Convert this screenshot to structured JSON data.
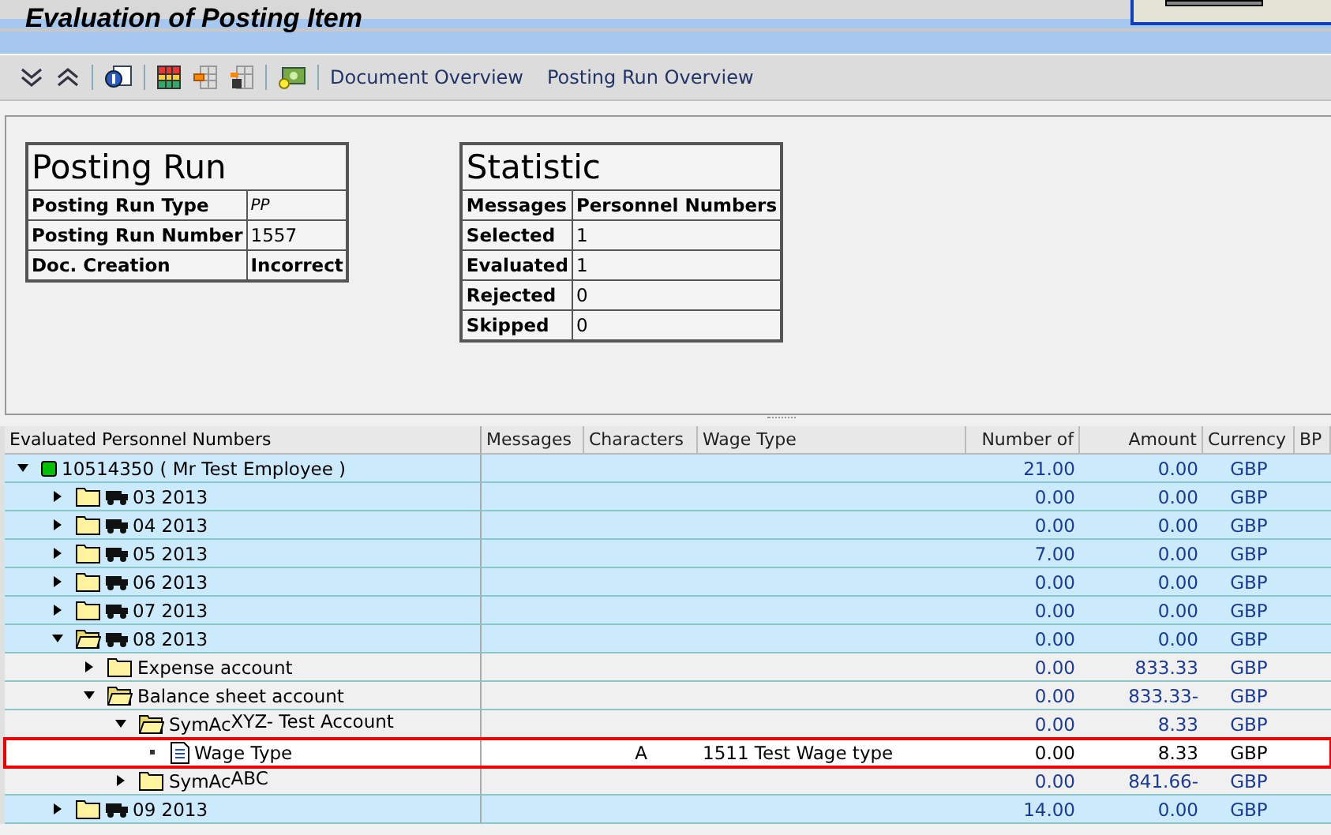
{
  "window": {
    "title": "Evaluation of Posting Item"
  },
  "toolbar": {
    "links": [
      "Document Overview",
      "Posting Run Overview"
    ]
  },
  "posting_run": {
    "title": "Posting Run",
    "rows": [
      {
        "label": "Posting Run Type",
        "value": "PP",
        "italic": true
      },
      {
        "label": "Posting Run Number",
        "value": "1557",
        "italic": false
      },
      {
        "label": "Doc. Creation",
        "value": "Incorrect",
        "italic": false,
        "bold": true
      }
    ]
  },
  "statistic": {
    "title": "Statistic",
    "header": [
      "Messages",
      "Personnel Numbers"
    ],
    "rows": [
      {
        "label": "Selected",
        "value": "1"
      },
      {
        "label": "Evaluated",
        "value": "1"
      },
      {
        "label": "Rejected",
        "value": "0"
      },
      {
        "label": "Skipped",
        "value": "0"
      }
    ]
  },
  "table": {
    "columns": [
      "Evaluated Personnel Numbers",
      "Messages",
      "Characters",
      "Wage Type",
      "Number of",
      "Amount",
      "Currency",
      "BP"
    ],
    "rows": [
      {
        "kind": "employee",
        "label": "10514350 ( Mr Test Employee )",
        "color": "#00c000",
        "expanded": true,
        "selected": false,
        "number": "21.00",
        "amount": "0.00",
        "currency": "GBP",
        "children": [
          {
            "kind": "period",
            "label": "03 2013",
            "expanded": false,
            "selected": false,
            "number": "0.00",
            "amount": "0.00",
            "currency": "GBP"
          },
          {
            "kind": "period",
            "label": "04 2013",
            "expanded": false,
            "selected": false,
            "number": "0.00",
            "amount": "0.00",
            "currency": "GBP"
          },
          {
            "kind": "period",
            "label": "05 2013",
            "expanded": false,
            "selected": false,
            "number": "7.00",
            "amount": "0.00",
            "currency": "GBP"
          },
          {
            "kind": "period",
            "label": "06 2013",
            "expanded": false,
            "selected": false,
            "number": "0.00",
            "amount": "0.00",
            "currency": "GBP"
          },
          {
            "kind": "period",
            "label": "07 2013",
            "expanded": false,
            "selected": false,
            "number": "0.00",
            "amount": "0.00",
            "currency": "GBP"
          },
          {
            "kind": "period",
            "label": "08 2013",
            "expanded": true,
            "selected": false,
            "number": "0.00",
            "amount": "0.00",
            "currency": "GBP",
            "children": [
              {
                "kind": "folder",
                "label": "Expense account",
                "expanded": false,
                "selected": false,
                "number": "0.00",
                "amount": "833.33",
                "currency": "GBP"
              },
              {
                "kind": "folder",
                "label": "Balance sheet account",
                "expanded": true,
                "selected": false,
                "number": "0.00",
                "amount": "833.33-",
                "currency": "GBP",
                "children": [
                  {
                    "kind": "folder",
                    "label": "SymAc",
                    "suffix": "XYZ- Test Account",
                    "expanded": true,
                    "selected": false,
                    "number": "0.00",
                    "amount": "8.33",
                    "currency": "GBP",
                    "children": [
                      {
                        "kind": "item",
                        "label": "Wage Type",
                        "selected": true,
                        "characters": "A",
                        "wage_type": "1511 Test Wage type",
                        "number": "0.00",
                        "amount": "8.33",
                        "currency": "GBP"
                      }
                    ]
                  },
                  {
                    "kind": "folder",
                    "label": "SymAc",
                    "suffix": "ABC",
                    "expanded": false,
                    "selected": false,
                    "number": "0.00",
                    "amount": "841.66-",
                    "currency": "GBP"
                  }
                ]
              }
            ]
          },
          {
            "kind": "period",
            "label": "09 2013",
            "expanded": false,
            "selected": false,
            "number": "14.00",
            "amount": "0.00",
            "currency": "GBP"
          }
        ]
      }
    ]
  }
}
